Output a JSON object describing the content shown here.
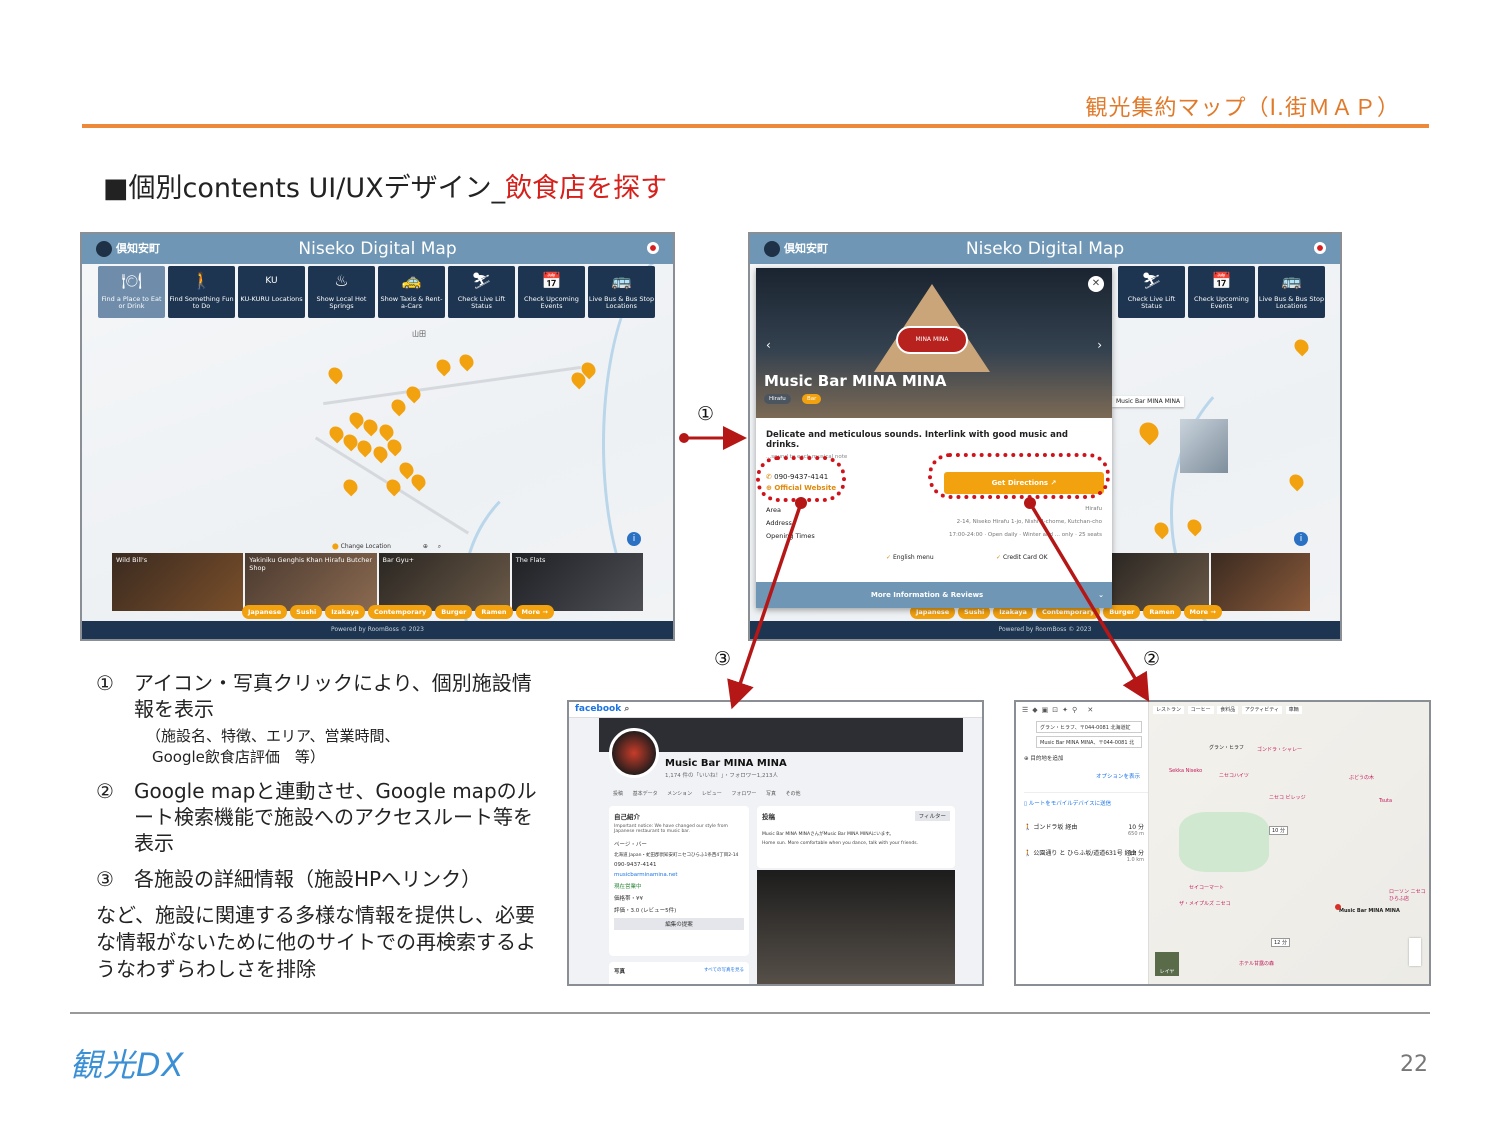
{
  "header": {
    "title": "観光集約マップ（Ⅰ.街ＭＡＰ）"
  },
  "section": {
    "prefix": "■個別contents UI/UXデザイン_",
    "highlight": "飲食店を探す"
  },
  "app": {
    "logo_text": "倶知安町",
    "title": "Niseko Digital Map",
    "footer": "Powered by RoomBoss © 2023",
    "tools": [
      {
        "icon": "🍽",
        "label": "Find a Place to Eat or Drink"
      },
      {
        "icon": "🚶",
        "label": "Find Something Fun to Do"
      },
      {
        "icon": "KU",
        "label": "KU-KURU Locations"
      },
      {
        "icon": "♨",
        "label": "Show Local Hot Springs"
      },
      {
        "icon": "🚕",
        "label": "Show Taxis & Rent-a-Cars"
      },
      {
        "icon": "⛷",
        "label": "Check Live Lift Status"
      },
      {
        "icon": "📅",
        "label": "Check Upcoming Events"
      },
      {
        "icon": "🚌",
        "label": "Live Bus & Bus Stop Locations"
      }
    ],
    "photos": [
      "Wild Bill's",
      "Yakiniku Genghis Khan Hirafu Butcher Shop",
      "Bar Gyu+",
      "The Flats"
    ],
    "chips": [
      "Japanese",
      "Sushi",
      "Izakaya",
      "Contemporary",
      "Burger",
      "Ramen",
      "More →"
    ],
    "change_location": "Change Location",
    "map_label": "山田"
  },
  "card": {
    "name": "Music Bar MINA MINA",
    "tag_area": "Hirafu",
    "tag_type": "Bar",
    "sign": "MINA MINA",
    "description": "Delicate and meticulous sounds. Interlink with good music and drinks.",
    "sub": "...sound to each musical note",
    "phone": "090-9437-4141",
    "website": "Official Website",
    "directions": "Get Directions",
    "area_label": "Area",
    "area_value": "Hirafu",
    "address_label": "Address",
    "address_value": "2-14, Niseko Hirafu 1-jo, Nishi 4-chome, Kutchan-cho",
    "hours_label": "Opening Times",
    "hours_value": "17:00-24:00 · Open daily · Winter and ... only · 25 seats",
    "feature1": "English menu",
    "feature2": "Credit Card OK",
    "more": "More Information & Reviews",
    "popup_label": "Music Bar MINA MINA"
  },
  "steps": {
    "s1": "①",
    "s2": "②",
    "s3": "③"
  },
  "notes": {
    "n1_num": "①",
    "n1_text": "アイコン・写真クリックにより、個別施設情報を表示",
    "n1_sub1": "（施設名、特徴、エリア、営業時間、",
    "n1_sub2": "Google飲食店評価　等）",
    "n2_num": "②",
    "n2_text": "Google mapと連動させ、Google mapのルート検索機能で施設へのアクセスルート等を表示",
    "n3_num": "③",
    "n3_text": "各施設の詳細情報（施設HPへリンク）",
    "tail": "など、施設に関連する多様な情報を提供し、必要な情報がないために他のサイトでの再検索するようなわずらわしさを排除"
  },
  "facebook": {
    "brand": "facebook",
    "page_name": "Music Bar MINA MINA",
    "sub": "1,174 件の「いいね！」・フォロワー1,213人",
    "tabs": "投稿 基本データ メンション レビュー フォロワー 写真 その他",
    "intro_title": "自己紹介",
    "intro_text": "Important notice: We have changed our style from Japanese restaurant to music bar.",
    "info": [
      "ページ・バー",
      "北海道 Japan・虻田郡倶知安町ニセコひらふ1条西4丁目2-14",
      "090-9437-4141",
      "musicbarminamina.net",
      "現在営業中",
      "価格帯・¥¥",
      "評価・3.0 (レビュー5件)"
    ],
    "edit": "編集の提案",
    "posts_title": "投稿",
    "filter": "フィルター",
    "post_author": "Music Bar MINA MINAさんがMusic Bar MINA MINAにいます。",
    "post_text": "Home sun. More comfortable when you dance, talk with your friends.",
    "photos_title": "写真",
    "photos_all": "すべての写真を見る"
  },
  "gmaps": {
    "origin": "グラン・ヒラフ、〒044-0081 北海道虻",
    "destination": "Music Bar MINA MINA、〒044-0081 北",
    "add": "目的地を追加",
    "options": "オプションを表示",
    "send": "ルートをモバイルデバイスに送信",
    "route1_name": "ゴンドラ坂 経由",
    "route1_time": "10 分",
    "route1_dist": "650 m",
    "route2_name": "公園通り と ひらふ坂/道道631号 経由",
    "route2_time": "12 分",
    "route2_dist": "1.0 km",
    "pin_label": "Music Bar MINA MINA",
    "start_label": "グラン・ヒラフ",
    "walk_label": "10 分",
    "walk2_label": "12 分",
    "filters": [
      "レストラン",
      "コーヒー",
      "食料品",
      "アクティビティ",
      "車輌"
    ],
    "layers": "レイヤ",
    "places": [
      "ゴンドラ・シャレー",
      "ニセコハイツ",
      "Sekka Niseko",
      "ニセコ ビレッジ",
      "ぶどうの木",
      "ザ・メイプルズ ニセコ",
      "Tsuta",
      "ローソン ニセコひらふ店",
      "セイコーマート",
      "ホテル甘露の森"
    ]
  },
  "footer": {
    "brand": "観光DX",
    "page": "22"
  }
}
